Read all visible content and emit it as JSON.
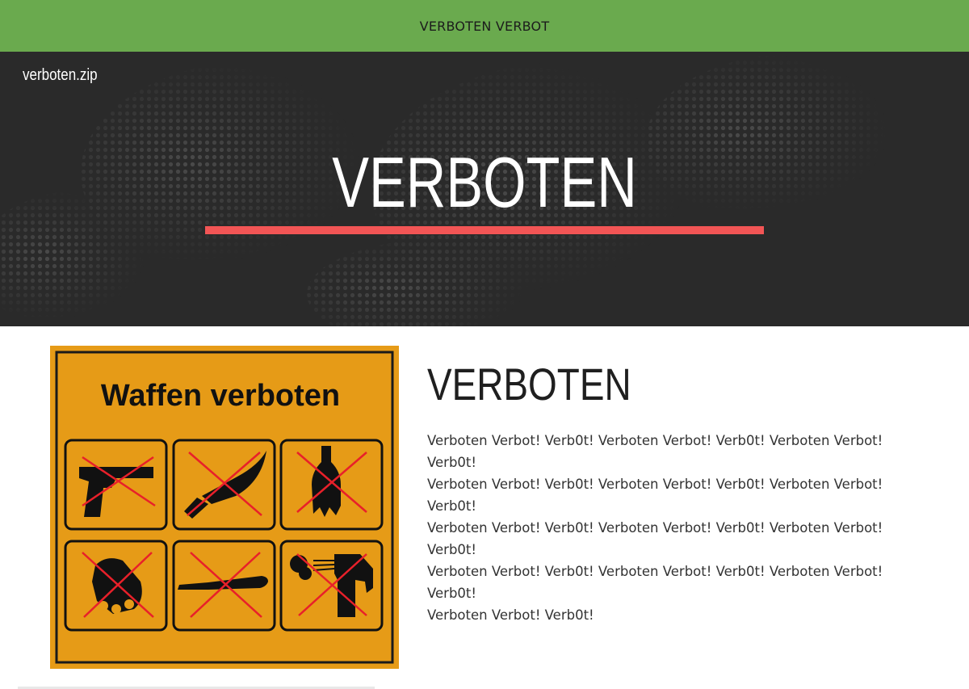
{
  "topbar": {
    "text": "VERBOTEN VERBOT"
  },
  "brand": {
    "label": "verboten.zip"
  },
  "hero": {
    "title": "VERBOTEN",
    "underline_color": "#f25555"
  },
  "sign": {
    "heading": "Waffen verboten",
    "background_color": "#e69b17",
    "icons": [
      "pistol-icon",
      "knife-icon",
      "broken-bottle-icon",
      "brass-knuckles-icon",
      "baseball-bat-icon",
      "pepper-spray-icon"
    ]
  },
  "section": {
    "title": "VERBOTEN",
    "lines": [
      "Verboten Verbot! Verb0t! Verboten Verbot! Verb0t! Verboten Verbot! Verb0t!",
      "Verboten Verbot! Verb0t! Verboten Verbot! Verb0t! Verboten Verbot! Verb0t!",
      "Verboten Verbot! Verb0t! Verboten Verbot! Verb0t! Verboten Verbot! Verb0t!",
      "Verboten Verbot! Verb0t! Verboten Verbot! Verb0t! Verboten Verbot! Verb0t!",
      "Verboten Verbot! Verb0t!"
    ]
  },
  "colors": {
    "topbar": "#6aaa4e",
    "hero_bg": "#2a2a2a"
  }
}
